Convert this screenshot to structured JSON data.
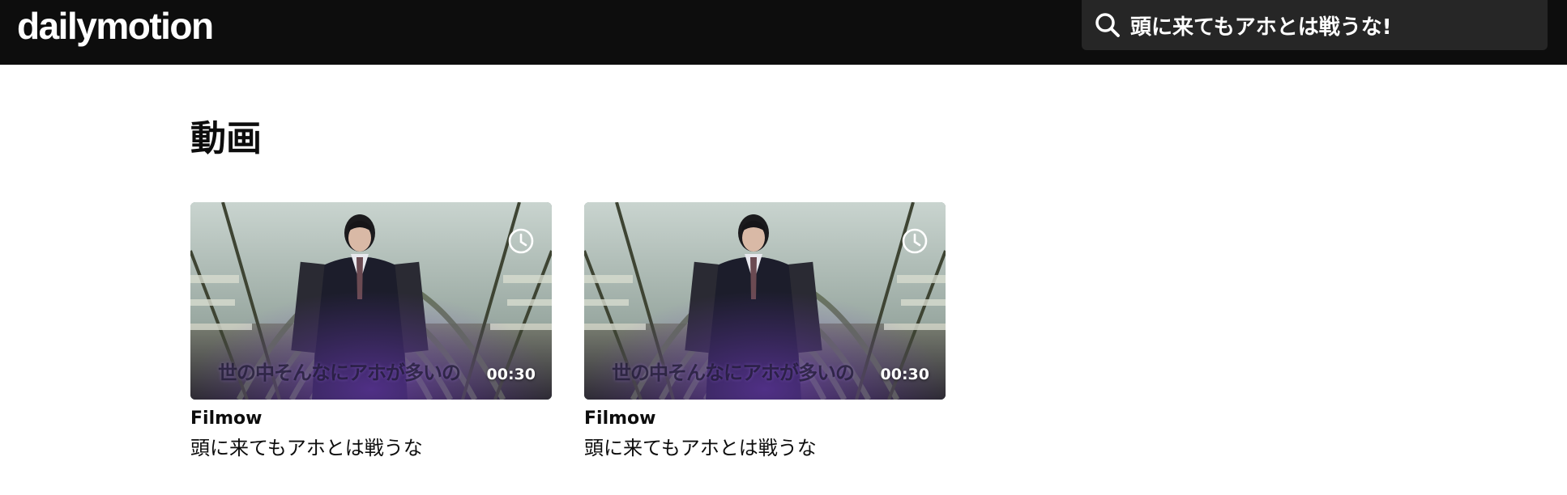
{
  "header": {
    "logo_text": "dailymotion",
    "search": {
      "value": "頭に来てもアホとは戦うな!",
      "icon": "search-icon"
    }
  },
  "main": {
    "section_title": "動画",
    "videos": [
      {
        "channel": "Filmow",
        "title": "頭に来てもアホとは戦うな",
        "duration": "00:30",
        "thumbnail_caption": "世の中そんなにアホが多いの",
        "overlay_icon": "watch-later-icon"
      },
      {
        "channel": "Filmow",
        "title": "頭に来てもアホとは戦うな",
        "duration": "00:30",
        "thumbnail_caption": "世の中そんなにアホが多いの",
        "overlay_icon": "watch-later-icon"
      }
    ]
  },
  "colors": {
    "header_bg": "#0d0d0d",
    "search_bg": "#262626",
    "page_bg": "#ffffff",
    "text": "#0d0d0d"
  }
}
